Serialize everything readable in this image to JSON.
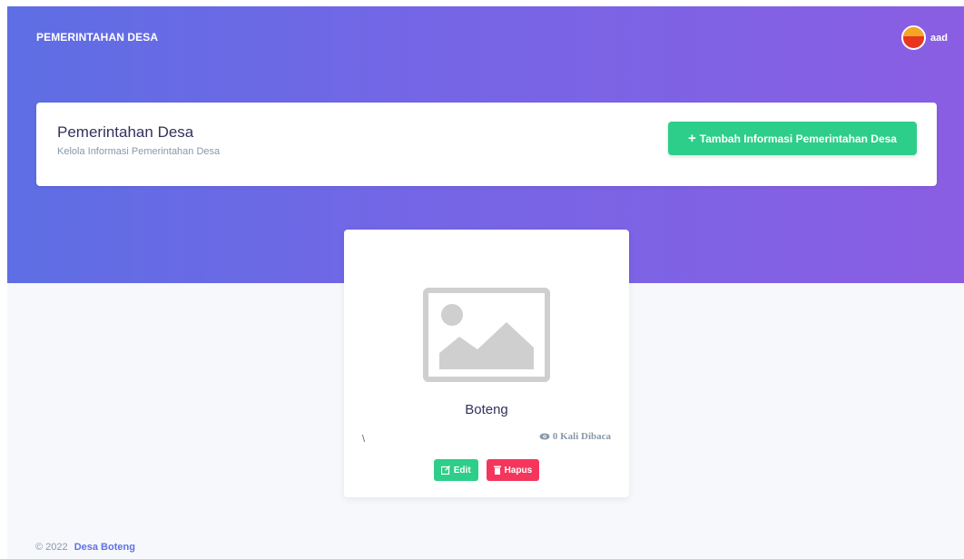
{
  "navbar": {
    "brand": "PEMERINTAHAN DESA",
    "user_name": "aad",
    "avatar_icon": "user-avatar"
  },
  "header": {
    "title": "Pemerintahan Desa",
    "subtitle": "Kelola Informasi Pemerintahan Desa",
    "add_button_label": "Tambah Informasi Pemerintahan Desa",
    "add_button_icon": "plus-icon"
  },
  "cards": [
    {
      "image_icon": "image-placeholder-icon",
      "title": "Boteng",
      "description": "\\",
      "views_label": "0 Kali Dibaca",
      "edit_label": "Edit",
      "delete_label": "Hapus"
    }
  ],
  "footer": {
    "copyright": "© 2022",
    "link_text": "Desa Boteng"
  },
  "colors": {
    "hero_gradient_start": "#5e6ee4",
    "hero_gradient_end": "#8a5ee3",
    "success": "#2dce89",
    "danger": "#f5365c",
    "link": "#5e72e4"
  }
}
